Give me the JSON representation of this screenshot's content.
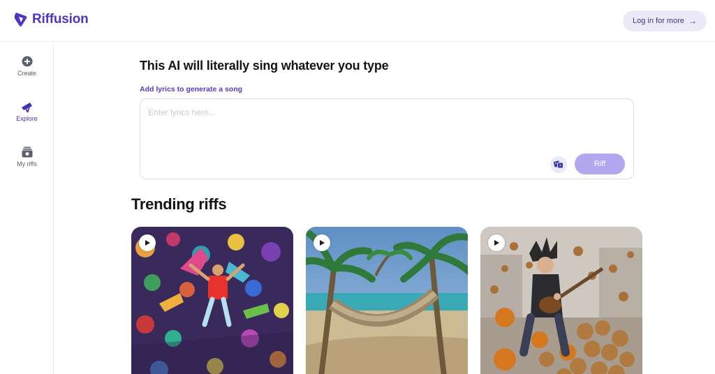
{
  "header": {
    "brand_name": "Riffusion",
    "login_label": "Log in for more",
    "login_icon": "arrow-right-icon",
    "accent_color": "#4a37c4"
  },
  "sidebar": {
    "items": [
      {
        "label": "Create",
        "icon": "plus-circle-icon",
        "active": false
      },
      {
        "label": "Explore",
        "icon": "telescope-icon",
        "active": true
      },
      {
        "label": "My riffs",
        "icon": "stack-icon",
        "active": false
      }
    ]
  },
  "composer": {
    "title": "This AI will literally sing whatever you type",
    "prompt_label": "Add lyrics to generate a song",
    "lyrics_placeholder": "Enter lyrics here...",
    "lyrics_value": "",
    "dice_icon": "dice-icon",
    "submit_label": "Riff",
    "submit_color": "#b3a8f0"
  },
  "trending": {
    "title": "Trending riffs",
    "cards": [
      {
        "art": "colorful-dancing-crowd",
        "play_icon": "play-icon"
      },
      {
        "art": "beach-hammock-palms",
        "play_icon": "play-icon"
      },
      {
        "art": "rocker-guitar-cookies",
        "play_icon": "play-icon"
      }
    ]
  }
}
